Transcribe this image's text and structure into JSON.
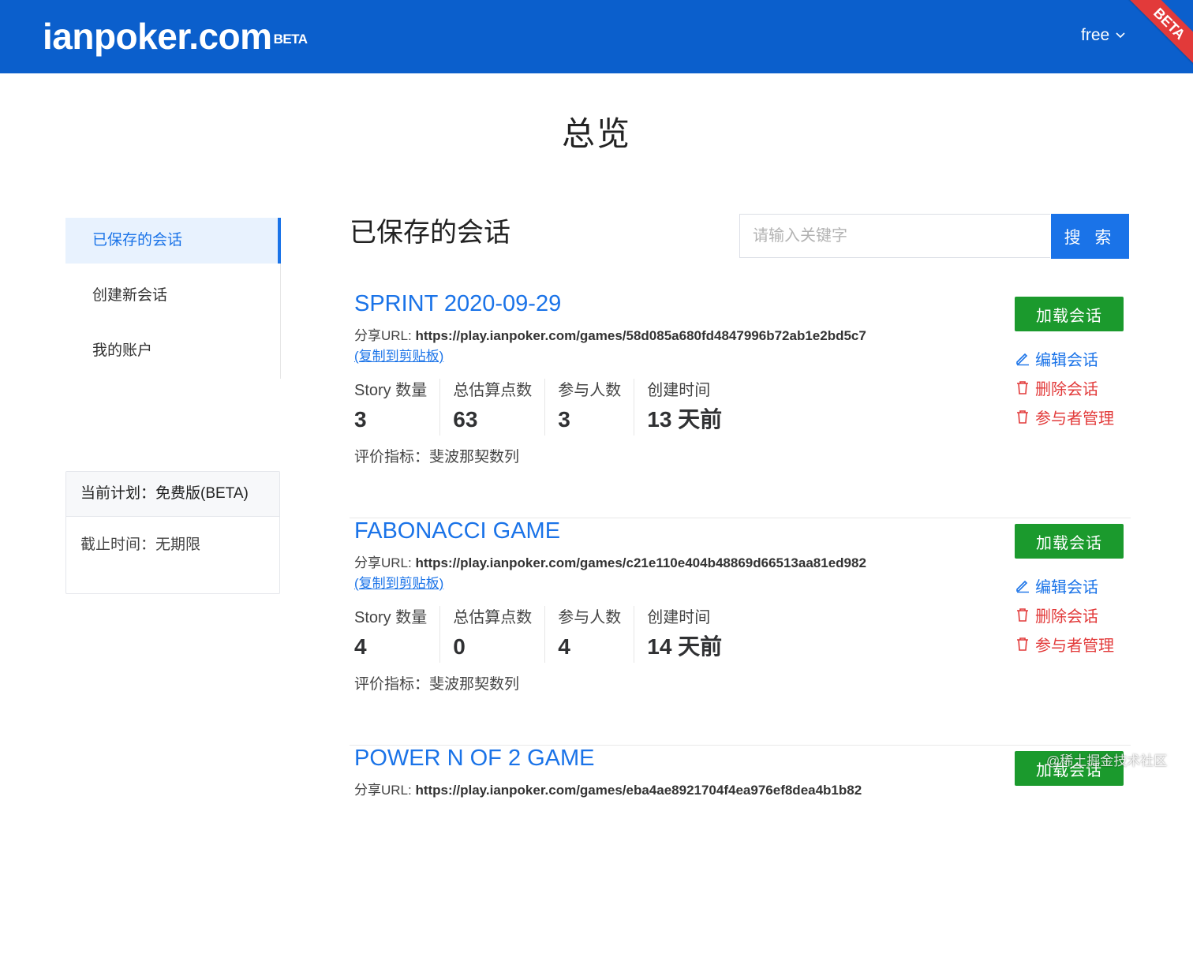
{
  "header": {
    "logo": "ianpoker.com",
    "logo_badge": "BETA",
    "plan_menu": "free",
    "ribbon": "BETA"
  },
  "page_title": "总览",
  "sidebar": {
    "items": [
      {
        "label": "已保存的会话"
      },
      {
        "label": "创建新会话"
      },
      {
        "label": "我的账户"
      }
    ]
  },
  "plan_card": {
    "current": "当前计划：免费版(BETA)",
    "expiry": "截止时间：无期限"
  },
  "main": {
    "section_title": "已保存的会话",
    "search_placeholder": "请输入关键字",
    "search_button": "搜 索"
  },
  "labels": {
    "share_prefix": "分享URL: ",
    "copy": "(复制到剪贴板)",
    "story_count": "Story 数量",
    "points": "总估算点数",
    "participants": "参与人数",
    "created": "创建时间",
    "metric_prefix": "评价指标：",
    "load": "加载会话",
    "edit": "编辑会话",
    "delete": "删除会话",
    "manage": "参与者管理"
  },
  "sessions": [
    {
      "title": "SPRINT 2020-09-29",
      "url": "https://play.ianpoker.com/games/58d085a680fd4847996b72ab1e2bd5c7",
      "stories": "3",
      "points": "63",
      "participants": "3",
      "created": "13 天前",
      "metric": "斐波那契数列"
    },
    {
      "title": "FABONACCI GAME",
      "url": "https://play.ianpoker.com/games/c21e110e404b48869d66513aa81ed982",
      "stories": "4",
      "points": "0",
      "participants": "4",
      "created": "14 天前",
      "metric": "斐波那契数列"
    },
    {
      "title": "POWER N OF 2 GAME",
      "url": "https://play.ianpoker.com/games/eba4ae8921704f4ea976ef8dea4b1b82"
    }
  ],
  "watermark": "@稀土掘金技术社区",
  "colors": {
    "header_bg": "#0b5fcc",
    "accent": "#1a73e8",
    "load_green": "#1b9a2d",
    "danger_red": "#e23a3a"
  }
}
